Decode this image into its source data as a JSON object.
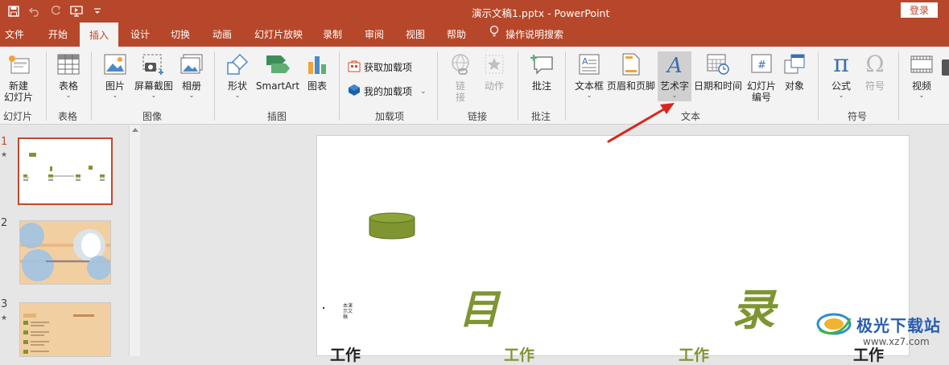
{
  "window": {
    "title": "演示文稿1.pptx  -  PowerPoint",
    "login_label": "登录"
  },
  "tabs": [
    {
      "label": "文件"
    },
    {
      "label": "开始"
    },
    {
      "label": "插入",
      "active": true
    },
    {
      "label": "设计"
    },
    {
      "label": "切换"
    },
    {
      "label": "动画"
    },
    {
      "label": "幻灯片放映"
    },
    {
      "label": "录制"
    },
    {
      "label": "审阅"
    },
    {
      "label": "视图"
    },
    {
      "label": "帮助"
    }
  ],
  "tellme": "操作说明搜索",
  "ribbon": {
    "new_slide": "新建\n幻灯片",
    "table": "表格",
    "picture": "图片",
    "screenshot": "屏幕截图",
    "album": "相册",
    "shapes": "形状",
    "smartart": "SmartArt",
    "chart": "图表",
    "get_addins": "获取加载项",
    "my_addins": "我的加载项",
    "link": "链\n接",
    "action": "动作",
    "comment": "批注",
    "textbox": "文本框",
    "header_footer": "页眉和页脚",
    "wordart": "艺术字",
    "datetime": "日期和时间",
    "slide_number": "幻灯片\n编号",
    "object": "对象",
    "equation": "公式",
    "symbol": "符号",
    "video": "视频"
  },
  "groups": {
    "slides": "幻灯片",
    "tables": "表格",
    "images": "图像",
    "illustrations": "插图",
    "addins": "加载项",
    "links": "链接",
    "comments": "批注",
    "text": "文本",
    "symbols": "符号"
  },
  "thumbnails": [
    {
      "number": "1",
      "star": "★"
    },
    {
      "number": "2"
    },
    {
      "number": "3",
      "star": "★"
    }
  ],
  "slide": {
    "char1": "目",
    "char2": "录",
    "small_text": "本演\n示文\n稿",
    "work_labels": [
      "工作",
      "工作",
      "工作",
      "工作"
    ]
  },
  "watermark": {
    "text": "极光下载站",
    "url": "www.xz7.com"
  },
  "colors": {
    "accent": "#b7472a",
    "olive": "#7e9532",
    "arrow": "#d9261c"
  }
}
